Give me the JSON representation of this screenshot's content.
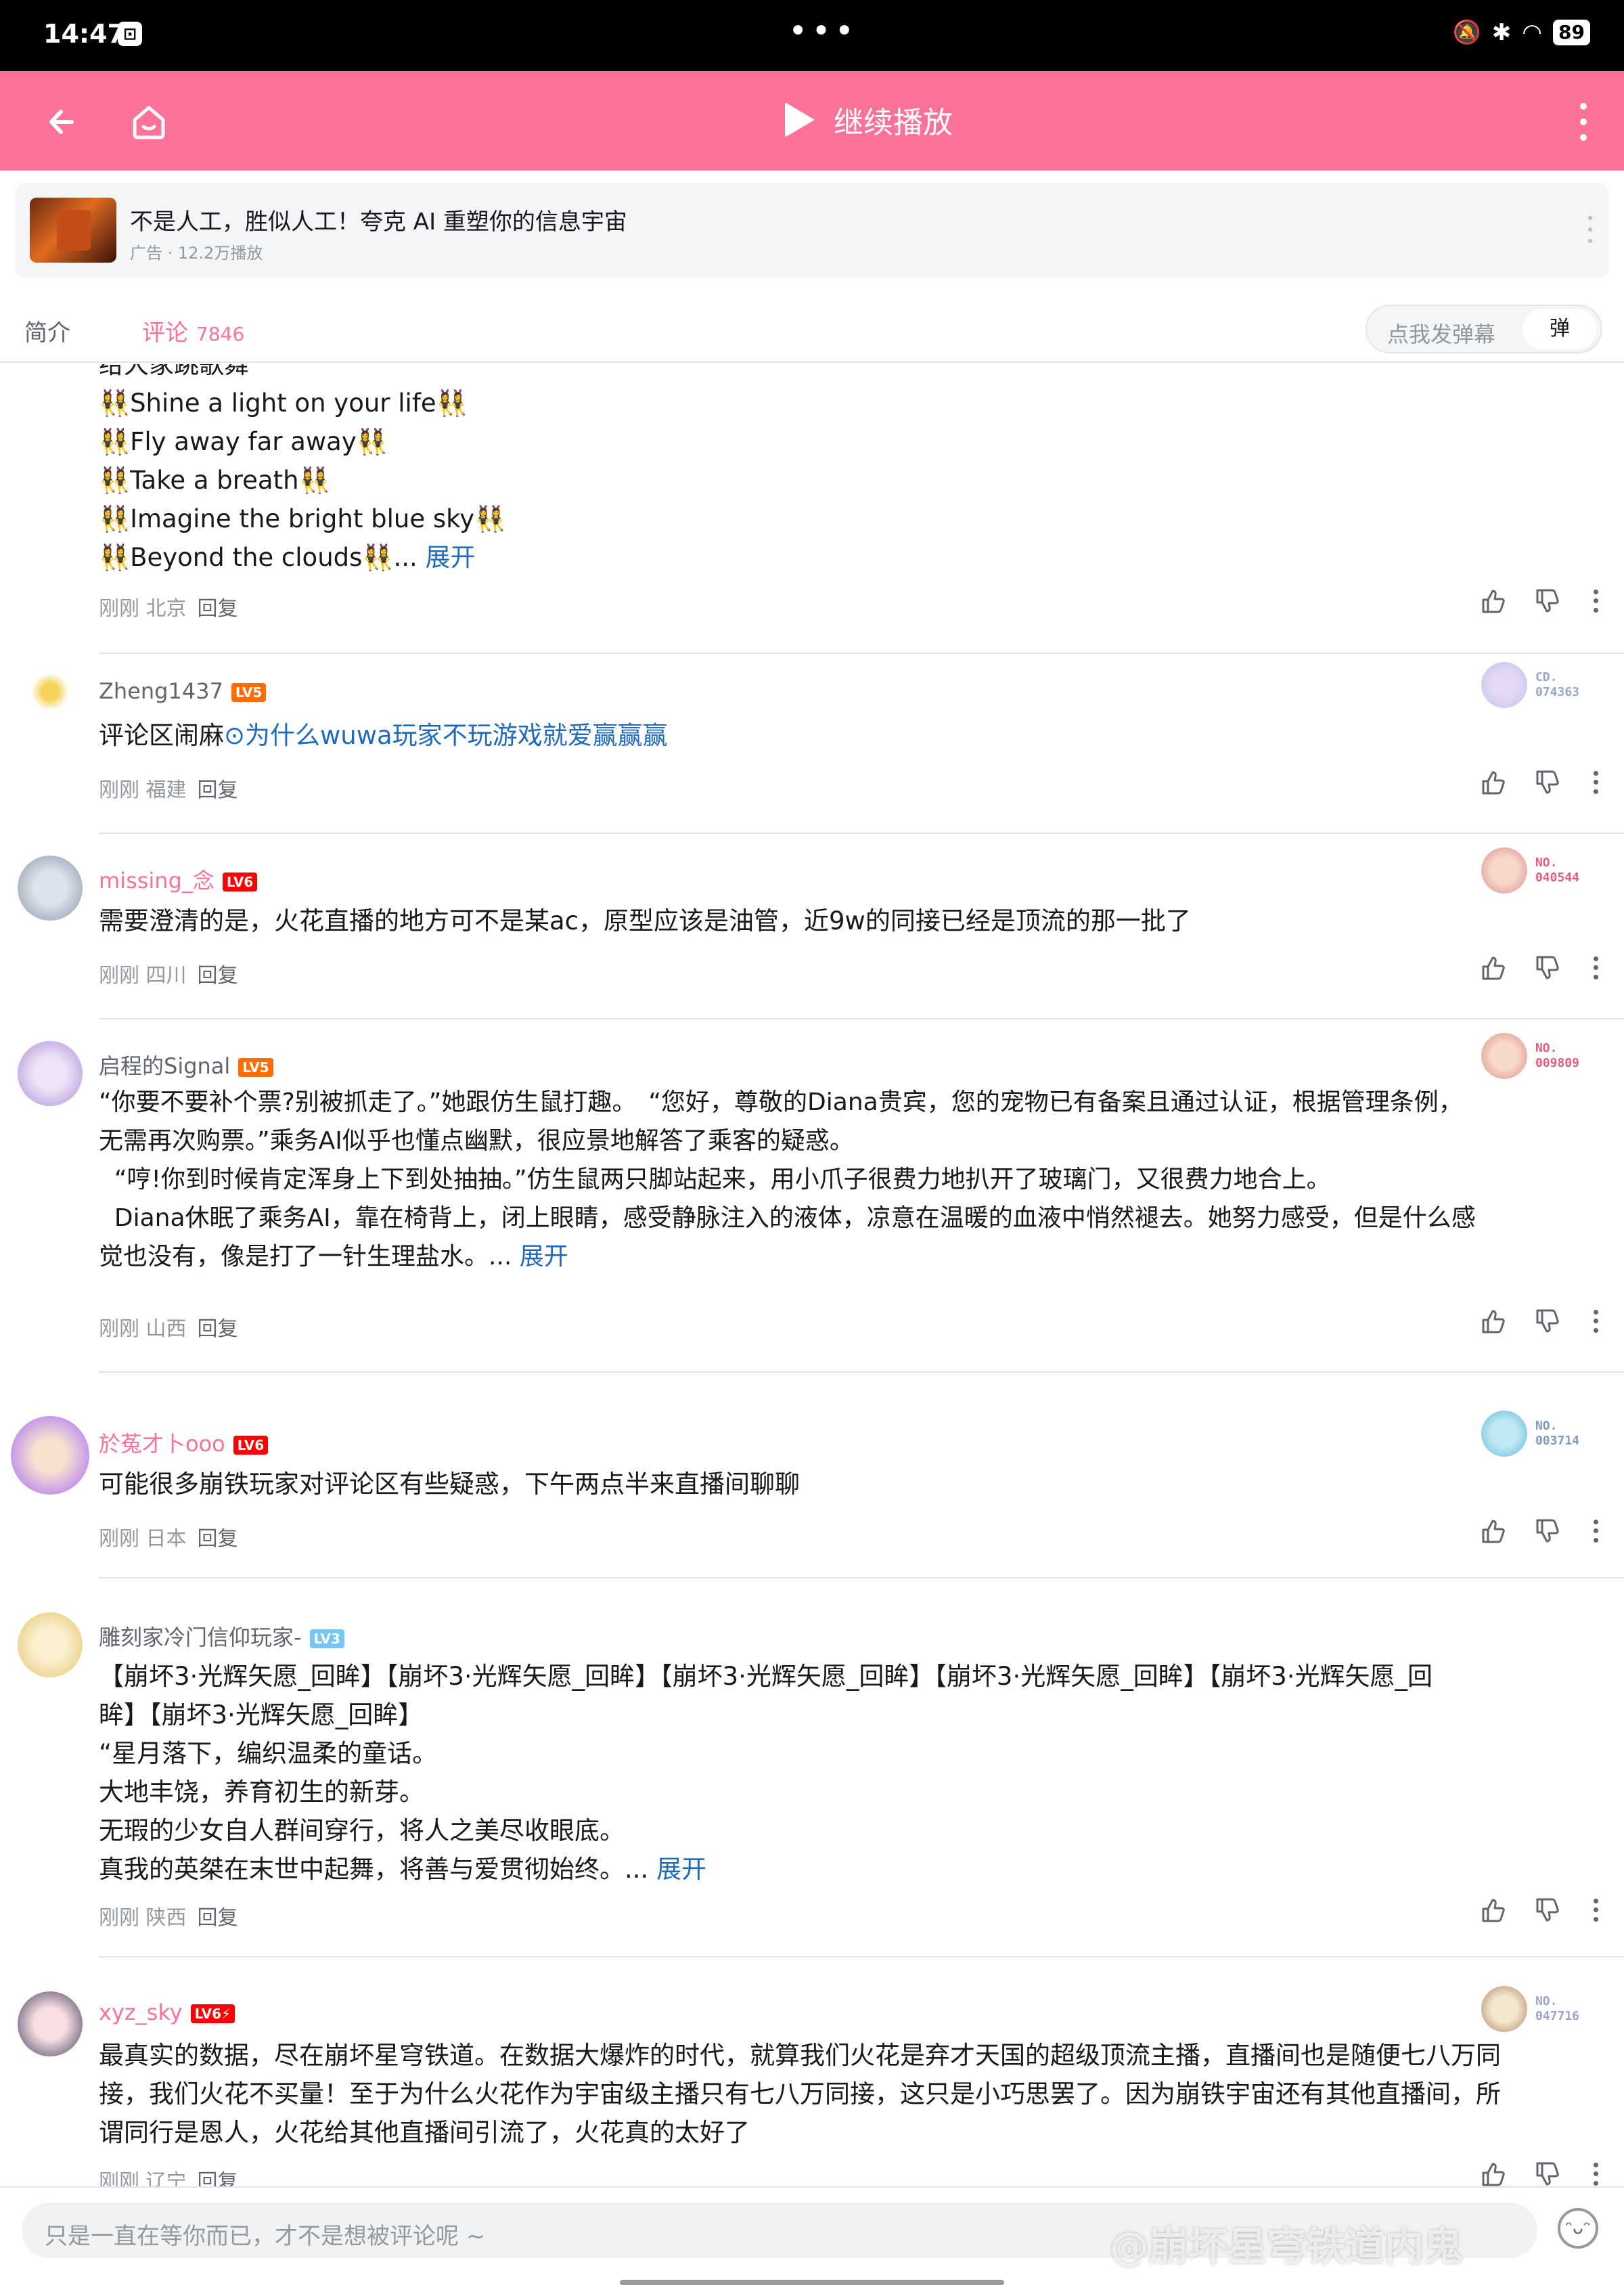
{
  "status_bar": {
    "time": "14:47",
    "dots": "•••",
    "battery": "89"
  },
  "top_bar": {
    "title": "继续播放"
  },
  "ad": {
    "title": "不是人工，胜似人工！夸克 AI 重塑你的信息宇宙",
    "meta": "广告 · 12.2万播放"
  },
  "tabs": {
    "intro": "简介",
    "comments": "评论",
    "comments_count": "7846",
    "danmaku_placeholder": "点我发弹幕",
    "danmaku_button": "弹"
  },
  "comments": [
    {
      "lines": [
        "给大家跳歌舞",
        "👯‍♀️Shine a light on your life👯‍♀️",
        "👯‍♀️Fly away far away👯‍♀️",
        "👯‍♀️Take a breath👯‍♀️",
        "👯‍♀️Imagine the bright blue sky👯‍♀️",
        "👯‍♀️Beyond the clouds👯‍♀️..."
      ],
      "expand": "展开",
      "time": "刚刚",
      "location": "北京",
      "reply": "回复"
    },
    {
      "username": "Zheng1437",
      "level": "LV5",
      "badge": "CD.\n074363",
      "text": "评论区闹麻",
      "link": "⊙为什么wuwa玩家不玩游戏就爱赢赢赢",
      "time": "刚刚",
      "location": "福建",
      "reply": "回复"
    },
    {
      "username": "missing_念",
      "level": "LV6",
      "badge": "NO.\n040544",
      "text": "需要澄清的是，火花直播的地方可不是某ac，原型应该是油管，近9w的同接已经是顶流的那一批了",
      "time": "刚刚",
      "location": "四川",
      "reply": "回复"
    },
    {
      "username": "启程的Signal",
      "level": "LV5",
      "badge": "NO.\n009809",
      "lines": [
        "“你要不要补个票?别被抓走了。”她跟仿生鼠打趣。　“您好，尊敬的Diana贵宾，您的宠物已有备案且通过认证，根据管理条例，",
        "无需再次购票。”乘务AI似乎也懂点幽默，很应景地解答了乘客的疑惑。",
        "  “哼!你到时候肯定浑身上下到处抽抽。”仿生鼠两只脚站起来，用小爪子很费力地扒开了玻璃门，又很费力地合上。",
        "",
        "  Diana休眠了乘务AI，靠在椅背上，闭上眼睛，感受静脉注入的液体，凉意在温暖的血液中悄然褪去。她努力感受，但是什么感",
        "觉也没有，像是打了一针生理盐水。..."
      ],
      "expand": "展开",
      "time": "刚刚",
      "location": "山西",
      "reply": "回复"
    },
    {
      "username": "於菟才卜ooo",
      "level": "LV6",
      "badge": "NO.\n003714",
      "text": "可能很多崩铁玩家对评论区有些疑惑，下午两点半来直播间聊聊",
      "time": "刚刚",
      "location": "日本",
      "reply": "回复"
    },
    {
      "username": "雕刻家冷门信仰玩家-",
      "level": "LV3",
      "lines": [
        "【崩坏3·光辉矢愿_回眸】【崩坏3·光辉矢愿_回眸】【崩坏3·光辉矢愿_回眸】【崩坏3·光辉矢愿_回眸】【崩坏3·光辉矢愿_回",
        "眸】【崩坏3·光辉矢愿_回眸】",
        "“星月落下，编织温柔的童话。",
        "大地丰饶，养育初生的新芽。",
        "无瑕的少女自人群间穿行，将人之美尽收眼底。",
        "真我的英桀在末世中起舞，将善与爱贯彻始终。..."
      ],
      "expand": "展开",
      "time": "刚刚",
      "location": "陕西",
      "reply": "回复"
    },
    {
      "username": "xyz_sky",
      "level": "LV6⚡",
      "badge": "NO.\n047716",
      "lines": [
        "最真实的数据，尽在崩坏星穹铁道。在数据大爆炸的时代，就算我们火花是弃才天国的超级顶流主播，直播间也是随便七八万同",
        "接，我们火花不买量！至于为什么火花作为宇宙级主播只有七八万同接，这只是小巧思罢了。因为崩铁宇宙还有其他直播间，所",
        "谓同行是恩人，火花给其他直播间引流了，火花真的太好了"
      ],
      "time": "刚刚",
      "location": "辽宁",
      "reply": "回复"
    }
  ],
  "bottom": {
    "placeholder": "只是一直在等你而已，才不是想被评论呢 ~",
    "watermark": "@崩坏星穹铁道内鬼"
  },
  "colors": {
    "brand_pink": "#fb7299",
    "link_blue": "#1e6bbe",
    "muted": "#9499a0"
  },
  "icons": [
    "back-arrow-icon",
    "home-icon",
    "play-icon",
    "more-vertical-icon",
    "like-icon",
    "dislike-icon",
    "emoji-icon"
  ]
}
